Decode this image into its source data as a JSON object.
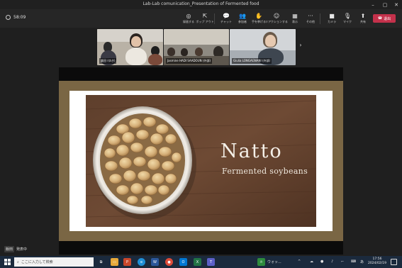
{
  "window": {
    "title": "Lab-Lab comunication_Presentation of Fermented food",
    "controls": [
      "minimize",
      "maximize",
      "close"
    ]
  },
  "toolbar": {
    "timer": "58:09",
    "buttons": [
      {
        "label": "録画する",
        "icon": "record-icon"
      },
      {
        "label": "ポップ アウト",
        "icon": "popout-icon"
      },
      {
        "label": "チャット",
        "icon": "chat-icon"
      },
      {
        "label": "参加者",
        "icon": "people-icon"
      },
      {
        "label": "手を挙げる",
        "icon": "raise-hand-icon"
      },
      {
        "label": "リアクションする",
        "icon": "reaction-icon"
      },
      {
        "label": "表示",
        "icon": "view-icon"
      },
      {
        "label": "その他",
        "icon": "more-icon"
      },
      {
        "label": "カメラ",
        "icon": "camera-icon"
      },
      {
        "label": "マイク",
        "icon": "mic-icon"
      },
      {
        "label": "共有",
        "icon": "share-icon"
      }
    ],
    "leave_label": "退出"
  },
  "participants": [
    {
      "name": "飯田 (ゆき)"
    },
    {
      "name": "Jasmine HADI SAADOUN (外部)"
    },
    {
      "name": "Giulia LONGAGNANI (外部)"
    }
  ],
  "slide": {
    "title": "Natto",
    "subtitle": "Fermented soybeans"
  },
  "presenter": {
    "name": "飯田",
    "status": "発表中"
  },
  "taskbar": {
    "search_placeholder": "ここに入力して検索",
    "weather_label": "ウォッ...",
    "time": "17:56",
    "date": "2024/02/19",
    "ime_label": "あ"
  },
  "colors": {
    "leave": "#c4314b",
    "slide_frame": "#7a6644",
    "taskbar": "#1b2a3d"
  }
}
